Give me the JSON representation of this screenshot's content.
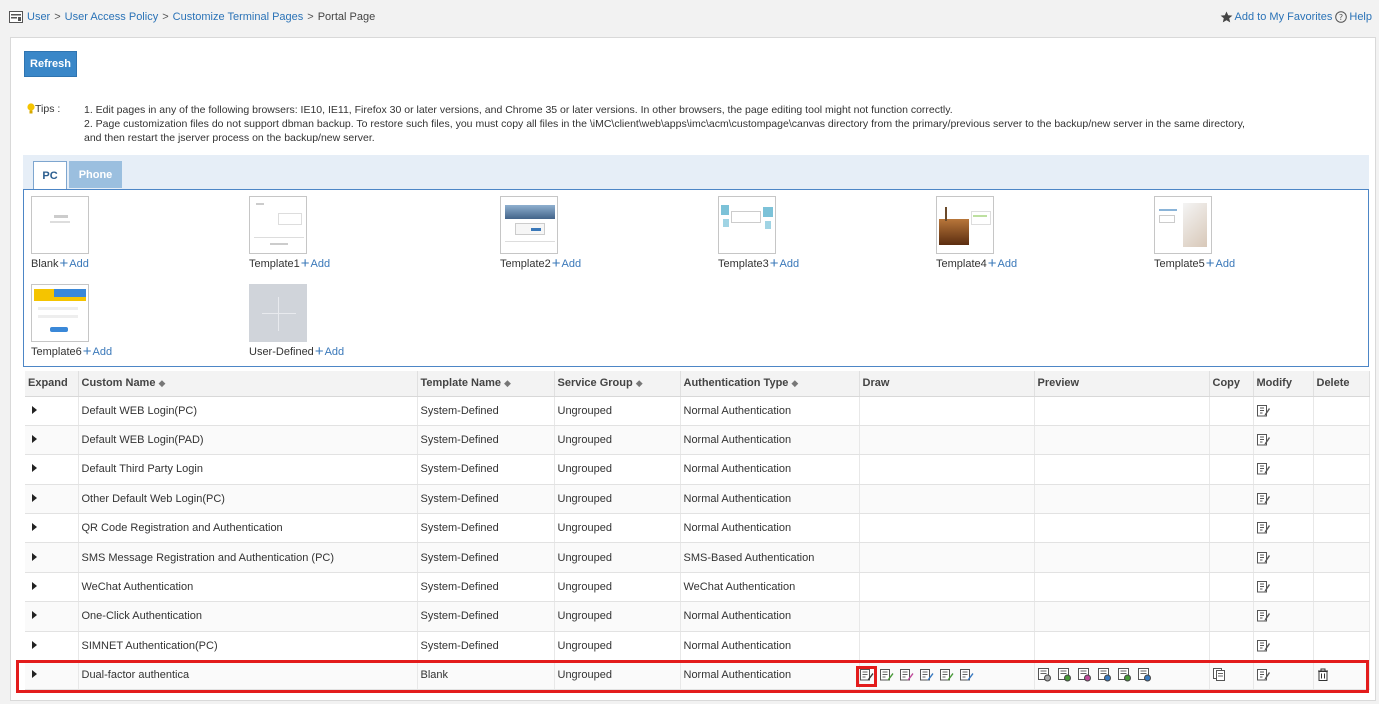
{
  "breadcrumb": {
    "items": [
      "User",
      "User Access Policy",
      "Customize Terminal Pages"
    ],
    "current": "Portal Page",
    "separator": ">"
  },
  "header_links": {
    "favorites": "Add to My Favorites",
    "help": "Help"
  },
  "toolbar": {
    "refresh_label": "Refresh"
  },
  "tips": {
    "label": "Tips :",
    "lines": [
      "1. Edit pages in any of the following browsers: IE10, IE11, Firefox 30 or later versions, and Chrome 35 or later versions. In other browsers, the page editing tool might not function correctly.",
      "2. Page customization files do not support dbman backup. To restore such files, you must copy all files in the \\iMC\\client\\web\\apps\\imc\\acm\\custompage\\canvas directory from the primary/previous server to the backup/new server in the same directory,",
      "and then restart the jserver process on the backup/new server."
    ]
  },
  "tabs": [
    {
      "label": "PC",
      "active": true
    },
    {
      "label": "Phone",
      "active": false
    }
  ],
  "templates": {
    "add_label": "Add",
    "items": [
      {
        "name": "Blank"
      },
      {
        "name": "Template1"
      },
      {
        "name": "Template2"
      },
      {
        "name": "Template3"
      },
      {
        "name": "Template4"
      },
      {
        "name": "Template5"
      },
      {
        "name": "Template6"
      },
      {
        "name": "User-Defined"
      }
    ]
  },
  "table": {
    "columns": [
      "Expand",
      "Custom Name",
      "Template Name",
      "Service Group",
      "Authentication Type",
      "Draw",
      "Preview",
      "Copy",
      "Modify",
      "Delete"
    ],
    "rows": [
      {
        "name": "Default WEB Login(PC)",
        "template": "System-Defined",
        "group": "Ungrouped",
        "auth": "Normal Authentication"
      },
      {
        "name": "Default WEB Login(PAD)",
        "template": "System-Defined",
        "group": "Ungrouped",
        "auth": "Normal Authentication"
      },
      {
        "name": "Default Third Party Login",
        "template": "System-Defined",
        "group": "Ungrouped",
        "auth": "Normal Authentication"
      },
      {
        "name": "Other Default Web Login(PC)",
        "template": "System-Defined",
        "group": "Ungrouped",
        "auth": "Normal Authentication"
      },
      {
        "name": "QR Code Registration and Authentication",
        "template": "System-Defined",
        "group": "Ungrouped",
        "auth": "Normal Authentication"
      },
      {
        "name": "SMS Message Registration and Authentication (PC)",
        "template": "System-Defined",
        "group": "Ungrouped",
        "auth": "SMS-Based Authentication"
      },
      {
        "name": "WeChat Authentication",
        "template": "System-Defined",
        "group": "Ungrouped",
        "auth": "WeChat Authentication"
      },
      {
        "name": "One-Click Authentication",
        "template": "System-Defined",
        "group": "Ungrouped",
        "auth": "Normal Authentication"
      },
      {
        "name": "SIMNET Authentication(PC)",
        "template": "System-Defined",
        "group": "Ungrouped",
        "auth": "Normal Authentication"
      },
      {
        "name": "Dual-factor authentica",
        "template": "Blank",
        "group": "Ungrouped",
        "auth": "Normal Authentication"
      }
    ]
  },
  "colors": {
    "accent": "#3a87c8",
    "link": "#2b73b7",
    "highlight": "#e31c1c"
  }
}
